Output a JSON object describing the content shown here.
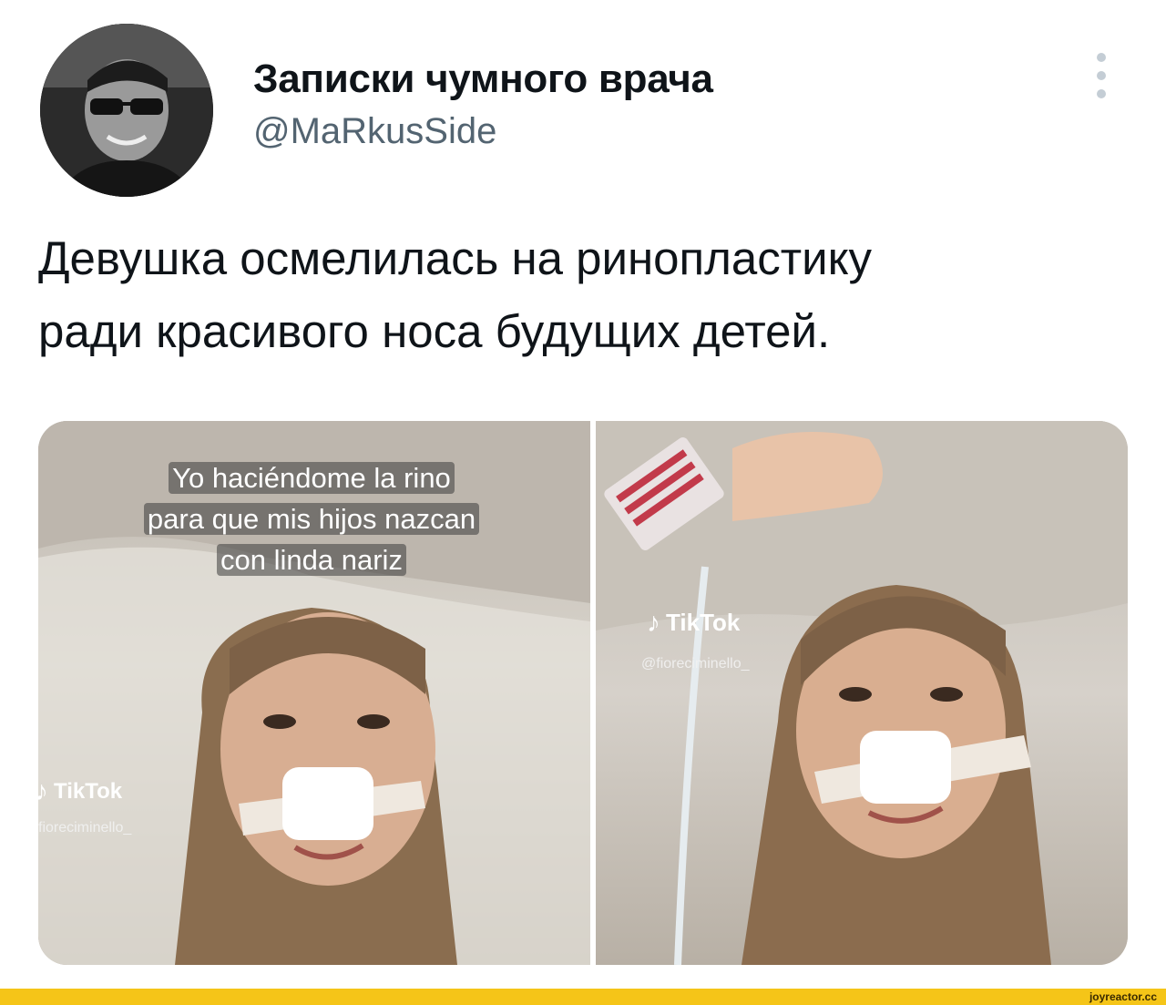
{
  "tweet": {
    "display_name": "Записки чумного врача",
    "handle": "@MaRkusSide",
    "text_lines": [
      "Девушка осмелилась на ринопластику",
      "ради красивого носа будущих детей."
    ]
  },
  "media": {
    "left_panel": {
      "caption_lines": [
        "Yo haciéndome la rino",
        "para que mis hijos nazcan",
        "con linda nariz"
      ],
      "watermark_brand": "TikTok",
      "watermark_user": "fioreciminello_"
    },
    "right_panel": {
      "watermark_brand": "TikTok",
      "watermark_user": "@fioreciminello_"
    }
  },
  "footer": {
    "site": "joyreactor.cc",
    "color": "#f5c518"
  },
  "icons": {
    "more": "more-vertical-icon",
    "tiktok": "tiktok-note-icon"
  }
}
